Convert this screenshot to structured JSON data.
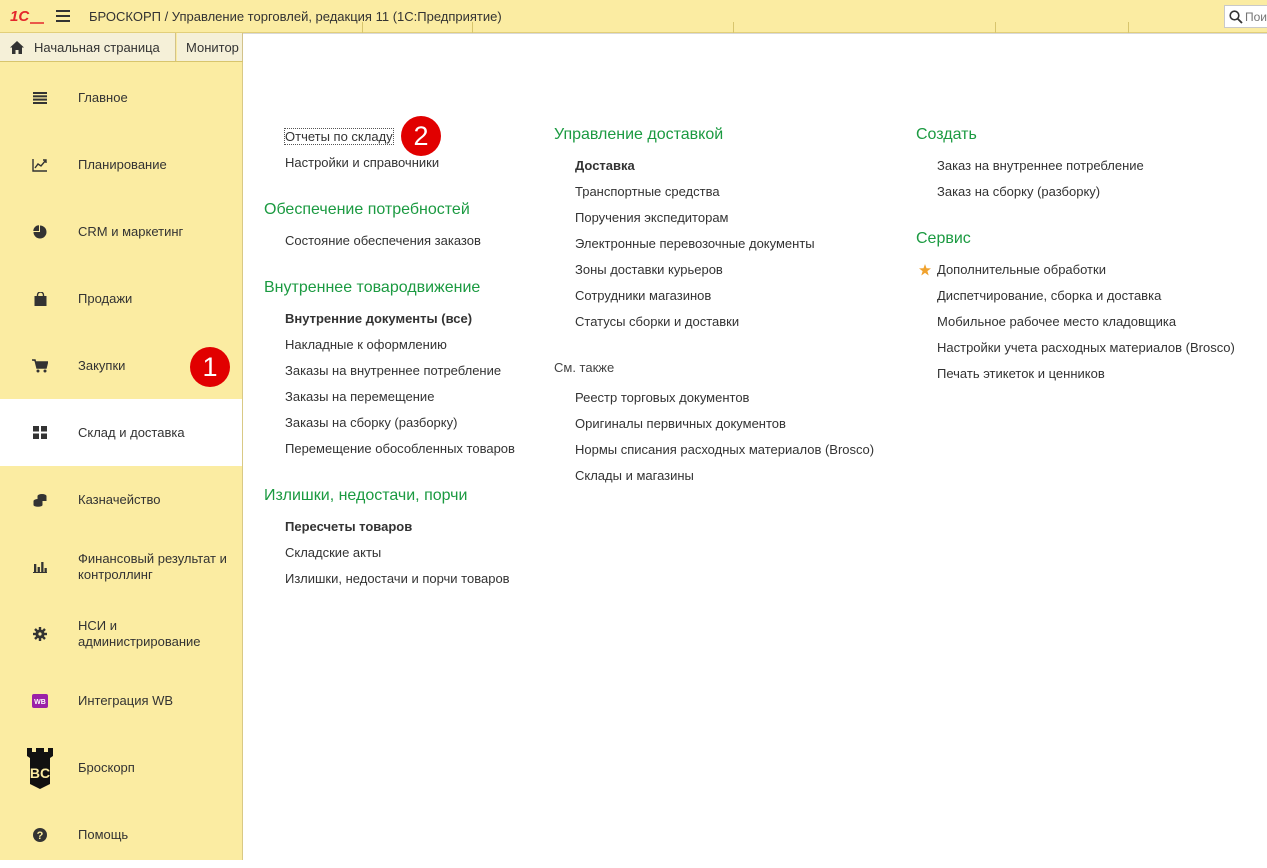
{
  "titlebar": {
    "logo_text": "1С",
    "title": "БРОСКОРП / Управление торговлей, редакция 11  (1С:Предприятие)",
    "search_placeholder": "Поиск"
  },
  "tabs": [
    {
      "label": "Начальная страница"
    },
    {
      "label": "Монитор"
    }
  ],
  "sidebar": {
    "items": [
      {
        "label": "Главное",
        "icon": "menu-list-icon"
      },
      {
        "label": "Планирование",
        "icon": "planning-icon"
      },
      {
        "label": "CRM и маркетинг",
        "icon": "pie-chart-icon"
      },
      {
        "label": "Продажи",
        "icon": "shopping-bag-icon"
      },
      {
        "label": "Закупки",
        "icon": "cart-icon"
      },
      {
        "label": "Склад и доставка",
        "icon": "grid-icon",
        "active": true
      },
      {
        "label": "Казначейство",
        "icon": "coins-icon"
      },
      {
        "label": "Финансовый результат и контроллинг",
        "icon": "bar-chart-icon"
      },
      {
        "label": "НСИ и администрирование",
        "icon": "gear-icon"
      },
      {
        "label": "Интеграция WB",
        "icon": "wb-icon",
        "icon_text": "WB"
      },
      {
        "label": "Броскорп",
        "icon": "brosco-logo-icon",
        "icon_text": "BC"
      },
      {
        "label": "Помощь",
        "icon": "help-icon"
      }
    ]
  },
  "badges": {
    "one": "1",
    "two": "2"
  },
  "colors": {
    "titlebar": "#fbeca2",
    "accent_green": "#1b9a41",
    "badge_red": "#e10000",
    "star": "#f0a22e"
  },
  "content": {
    "col1": {
      "top_links": [
        "Отчеты по складу",
        "Настройки и справочники"
      ],
      "groups": [
        {
          "title": "Обеспечение потребностей",
          "links": [
            "Состояние обеспечения заказов"
          ]
        },
        {
          "title": "Внутреннее товародвижение",
          "links": [
            "Внутренние документы (все)",
            "Накладные к оформлению",
            "Заказы на внутреннее потребление",
            "Заказы на перемещение",
            "Заказы на сборку (разборку)",
            "Перемещение обособленных товаров"
          ]
        },
        {
          "title": "Излишки, недостачи, порчи",
          "links": [
            "Пересчеты товаров",
            "Складские акты",
            "Излишки, недостачи и порчи товаров"
          ]
        }
      ]
    },
    "col2": {
      "groups": [
        {
          "title": "Управление доставкой",
          "links": [
            "Доставка",
            "Транспортные средства",
            "Поручения экспедиторам",
            "Электронные перевозочные документы",
            "Зоны доставки курьеров",
            "Сотрудники магазинов",
            "Статусы сборки и доставки"
          ]
        }
      ],
      "see_also_label": "См. также",
      "see_also": [
        "Реестр торговых документов",
        "Оригиналы первичных документов",
        "Нормы списания расходных материалов (Brosco)",
        "Склады и магазины"
      ]
    },
    "col3": {
      "groups": [
        {
          "title": "Создать",
          "links": [
            "Заказ на внутреннее потребление",
            "Заказ на сборку (разборку)"
          ]
        },
        {
          "title": "Сервис",
          "links": [
            "Дополнительные обработки",
            "Диспетчирование, сборка и доставка",
            "Мобильное рабочее место кладовщика",
            "Настройки учета расходных материалов (Brosco)",
            "Печать этикеток и ценников"
          ]
        }
      ]
    }
  }
}
